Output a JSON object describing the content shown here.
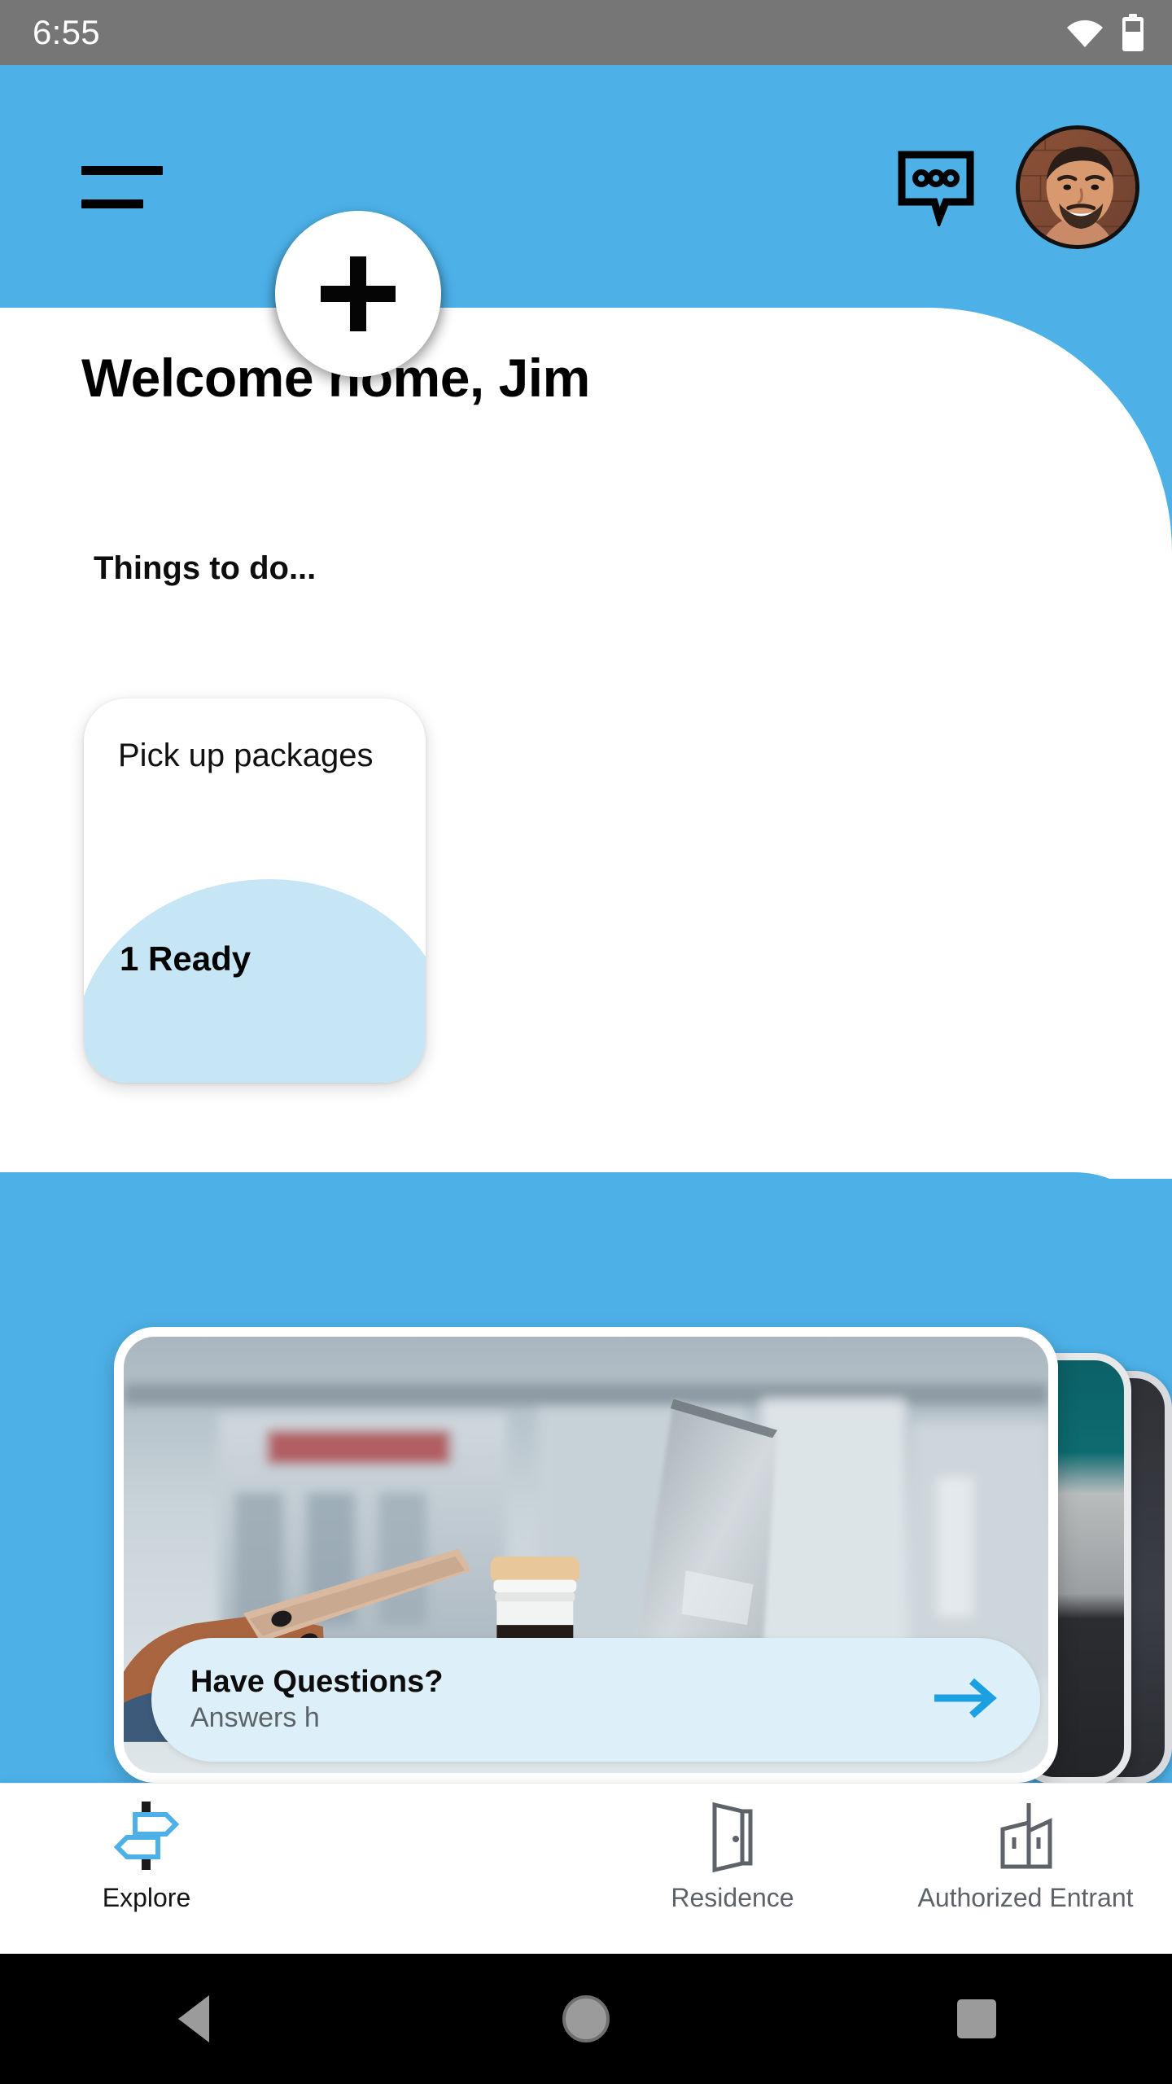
{
  "status_bar": {
    "time": "6:55",
    "wifi_icon": "wifi-icon",
    "battery_icon": "battery-icon",
    "background_color": "#767676"
  },
  "app_bar": {
    "menu_icon": "hamburger-menu-icon",
    "chat_icon": "chat-bubble-icon",
    "avatar_icon": "user-avatar",
    "background_color": "#4db1e8"
  },
  "main": {
    "greeting": "Welcome home, Jim",
    "section_label": "Things to do...",
    "todo_cards": [
      {
        "title": "Pick up packages",
        "status": "1 Ready",
        "blob_color": "#c6e6f5"
      }
    ]
  },
  "carousel": {
    "banner": {
      "title": "Have Questions?",
      "subtitle": "Answers h",
      "arrow_icon": "arrow-right-icon",
      "background_color": "#ddeff8",
      "arrow_color": "#1ba1e2"
    },
    "stacked_cards": 2
  },
  "bottom_nav": {
    "items": [
      {
        "label": "Explore",
        "icon": "signpost-icon",
        "active": true
      },
      {
        "label": "Residence",
        "icon": "open-door-icon",
        "active": false
      },
      {
        "label": "Authorized Entrant",
        "icon": "buildings-icon",
        "active": false
      }
    ],
    "fab": {
      "icon": "plus-icon",
      "label": ""
    },
    "active_color": "#151515",
    "inactive_color": "#5d6368",
    "accent_color": "#4db1e8"
  },
  "android_nav": {
    "back_icon": "triangle-back-icon",
    "home_icon": "circle-home-icon",
    "recents_icon": "square-recents-icon",
    "background_color": "#000000"
  },
  "theme": {
    "brand_blue": "#4db1e8",
    "light_blue": "#c6e6f5",
    "sheet_white": "#ffffff"
  }
}
